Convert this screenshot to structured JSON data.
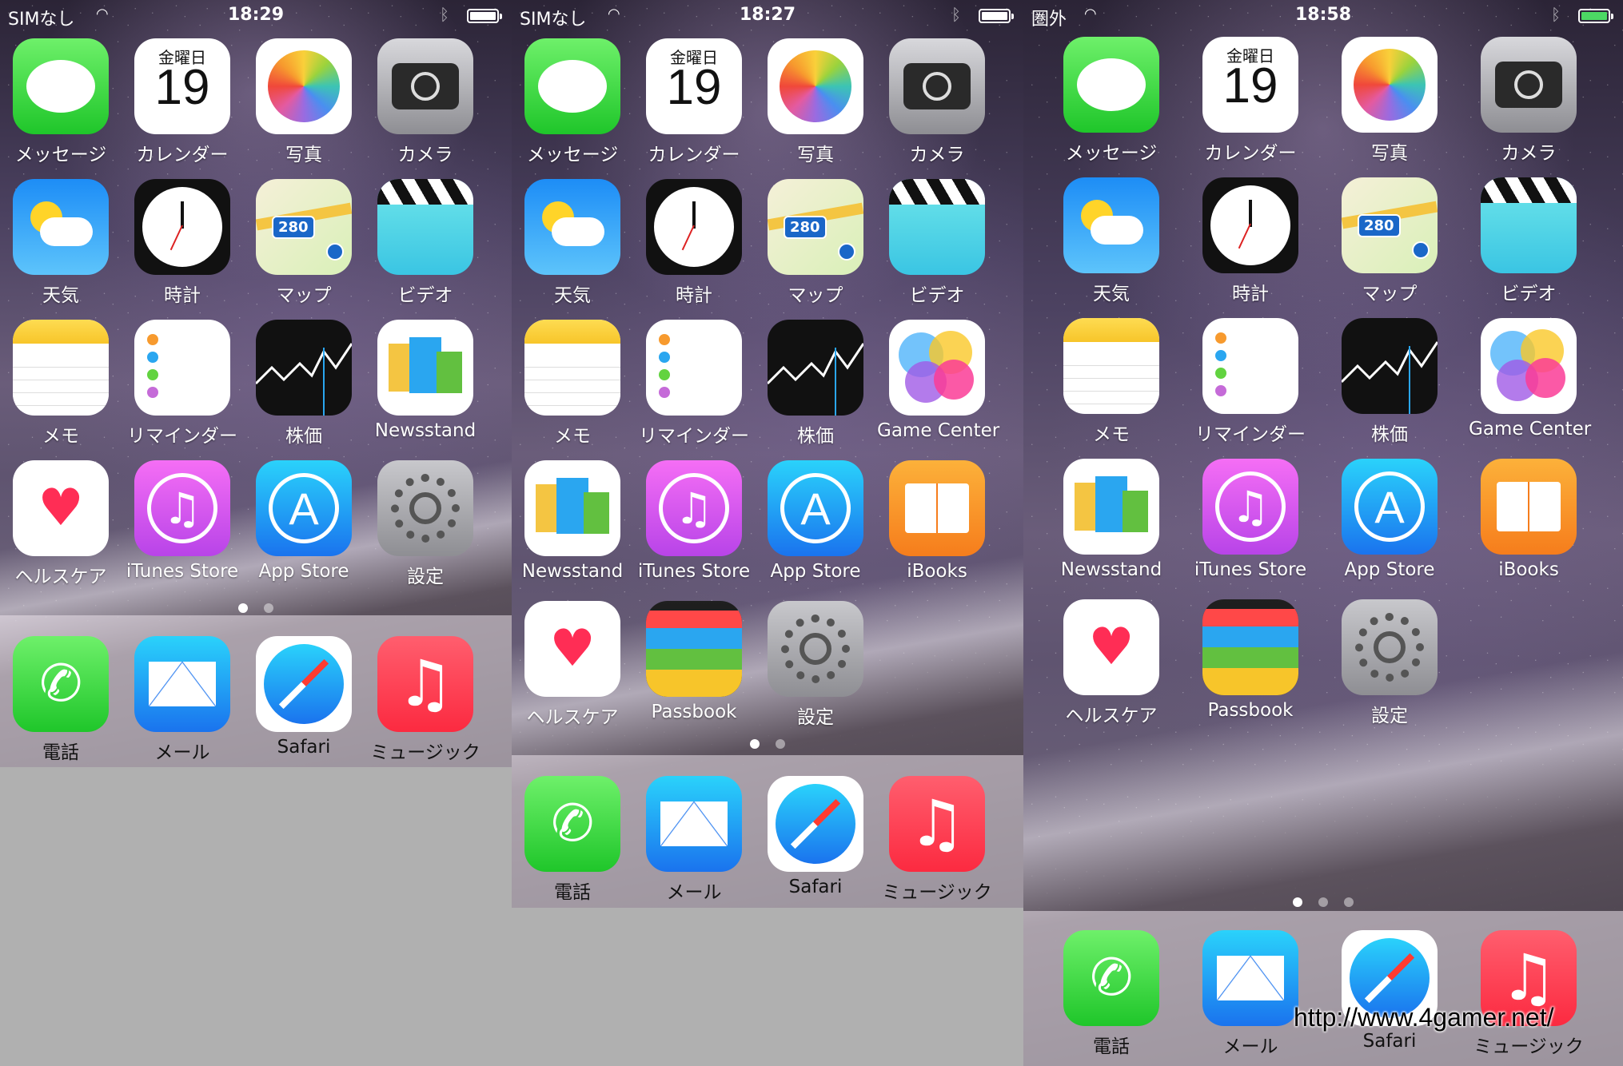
{
  "screens": [
    {
      "carrier": "SIMなし",
      "time": "18:29",
      "battery": "white",
      "apps": [
        "メッセージ",
        "カレンダー",
        "写真",
        "カメラ",
        "天気",
        "時計",
        "マップ",
        "ビデオ",
        "メモ",
        "リマインダー",
        "株価",
        "Newsstand",
        "ヘルスケア",
        "iTunes Store",
        "App Store",
        "設定"
      ],
      "dock": [
        "電話",
        "メール",
        "Safari",
        "ミュージック"
      ],
      "page_count": 2,
      "current_page": 1
    },
    {
      "carrier": "SIMなし",
      "time": "18:27",
      "battery": "white",
      "apps": [
        "メッセージ",
        "カレンダー",
        "写真",
        "カメラ",
        "天気",
        "時計",
        "マップ",
        "ビデオ",
        "メモ",
        "リマインダー",
        "株価",
        "Game Center",
        "Newsstand",
        "iTunes Store",
        "App Store",
        "iBooks",
        "ヘルスケア",
        "Passbook",
        "設定"
      ],
      "dock": [
        "電話",
        "メール",
        "Safari",
        "ミュージック"
      ],
      "page_count": 2,
      "current_page": 1
    },
    {
      "carrier": "圏外",
      "time": "18:58",
      "battery": "green",
      "apps": [
        "メッセージ",
        "カレンダー",
        "写真",
        "カメラ",
        "天気",
        "時計",
        "マップ",
        "ビデオ",
        "メモ",
        "リマインダー",
        "株価",
        "Game Center",
        "Newsstand",
        "iTunes Store",
        "App Store",
        "iBooks",
        "ヘルスケア",
        "Passbook",
        "設定"
      ],
      "dock": [
        "電話",
        "メール",
        "Safari",
        "ミュージック"
      ],
      "page_count": 3,
      "current_page": 1
    }
  ],
  "calendar": {
    "weekday": "金曜日",
    "day": "19"
  },
  "maps_shield": "280",
  "watermark": "http://www.4gamer.net/"
}
